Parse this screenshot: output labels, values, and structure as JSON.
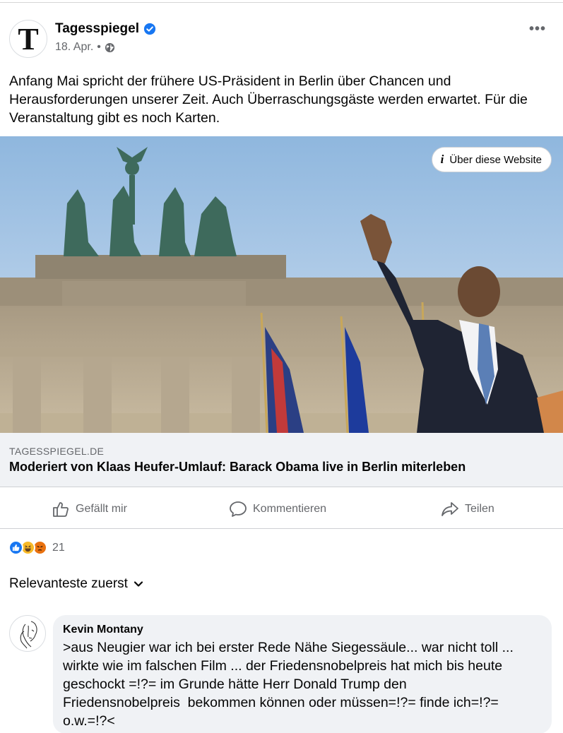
{
  "post": {
    "page_name": "Tagesspiegel",
    "avatar_letter": "T",
    "date": "18. Apr.",
    "separator": "•",
    "text": "Anfang Mai spricht der frühere US-Präsident in Berlin über Chancen und Herausforderungen unserer Zeit. Auch Überraschungsgäste werden erwartet. Für die Veranstaltung gibt es noch Karten.",
    "more_label": "•••"
  },
  "link": {
    "about_label": "Über diese Website",
    "about_icon": "info-icon",
    "domain": "TAGESSPIEGEL.DE",
    "title": "Moderiert von Klaas Heufer-Umlauf: Barack Obama live in Berlin miterleben"
  },
  "actions": {
    "like_label": "Gefällt mir",
    "comment_label": "Kommentieren",
    "share_label": "Teilen"
  },
  "reactions": {
    "icons": [
      "like-icon",
      "haha-icon",
      "angry-icon"
    ],
    "count": "21"
  },
  "sort": {
    "label": "Relevanteste zuerst"
  },
  "comment": {
    "author": "Kevin Montany",
    "text": ">aus Neugier war ich bei erster Rede Nähe Siegessäule... war nicht toll ...\nwirkte wie im falschen Film ... der Friedensnobelpreis hat mich bis heute\ngeschockt =!?= im Grunde hätte Herr Donald Trump den\nFriedensnobelpreis  bekommen können oder müssen=!?= finde ich=!?=\no.w.=!?<"
  },
  "colors": {
    "facebook_blue": "#1877f2",
    "secondary_text": "#65676b",
    "bubble_bg": "#f0f2f5"
  }
}
